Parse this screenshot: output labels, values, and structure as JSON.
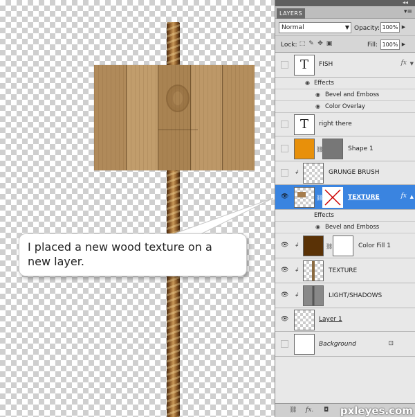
{
  "callout": {
    "text": "I placed a new wood texture on a new layer."
  },
  "panel": {
    "tab_label": "LAYERS",
    "collapse_glyph": "◂◂",
    "menu_glyph": "▾≡",
    "blend_mode": "Normal",
    "opacity_label": "Opacity:",
    "opacity_value": "100%",
    "lock_label": "Lock:",
    "fill_label": "Fill:",
    "fill_value": "100%"
  },
  "layers": [
    {
      "name": "FISH",
      "visible": false,
      "thumb": "text",
      "fx": true
    },
    {
      "sub": "Effects"
    },
    {
      "sub": "Bevel and Emboss"
    },
    {
      "sub": "Color Overlay"
    },
    {
      "name": "right there",
      "visible": false,
      "thumb": "text"
    },
    {
      "name": "Shape 1",
      "visible": false,
      "thumb": "shape"
    },
    {
      "name": "GRUNGE BRUSH",
      "visible": false,
      "thumb": "checker",
      "clipped": true
    },
    {
      "name": "TEXTURE",
      "visible": true,
      "thumb": "texture-mask",
      "clipped": true,
      "fx": true,
      "selected": true
    },
    {
      "sub": "Effects"
    },
    {
      "sub": "Bevel and Emboss"
    },
    {
      "name": "Color Fill 1",
      "visible": true,
      "thumb": "fill",
      "clipped": true
    },
    {
      "name": "TEXTURE",
      "visible": true,
      "thumb": "checker-pole",
      "clipped": true
    },
    {
      "name": "LIGHT/SHADOWS",
      "visible": true,
      "thumb": "gray",
      "clipped": true
    },
    {
      "name": "Layer 1",
      "visible": true,
      "thumb": "checker",
      "underline": true
    },
    {
      "name": "Background",
      "visible": false,
      "thumb": "white",
      "italic": true,
      "locked": true
    }
  ],
  "layer_names": {
    "fish": "FISH",
    "right_there": "right there",
    "shape1": "Shape 1",
    "grunge": "GRUNGE BRUSH",
    "texture_sel": "TEXTURE",
    "color_fill": "Color Fill 1",
    "texture2": "TEXTURE",
    "light": "LIGHT/SHADOWS",
    "layer1": "Layer 1",
    "background": "Background"
  },
  "effects": {
    "effects_label": "Effects",
    "bevel": "Bevel and Emboss",
    "color_overlay": "Color Overlay"
  },
  "icons": {
    "eye": "👁",
    "fx": "fx",
    "chain": "⛓",
    "lock": "🔒",
    "text_thumb": "T"
  },
  "bottom_bar": {
    "link": "⛓",
    "fx": "fx.",
    "mask": "◘"
  },
  "watermark": "pxleyes.com",
  "colors": {
    "selection": "#3a84e0",
    "shape_orange": "#e8900a",
    "fill_brown": "#5a3206"
  }
}
